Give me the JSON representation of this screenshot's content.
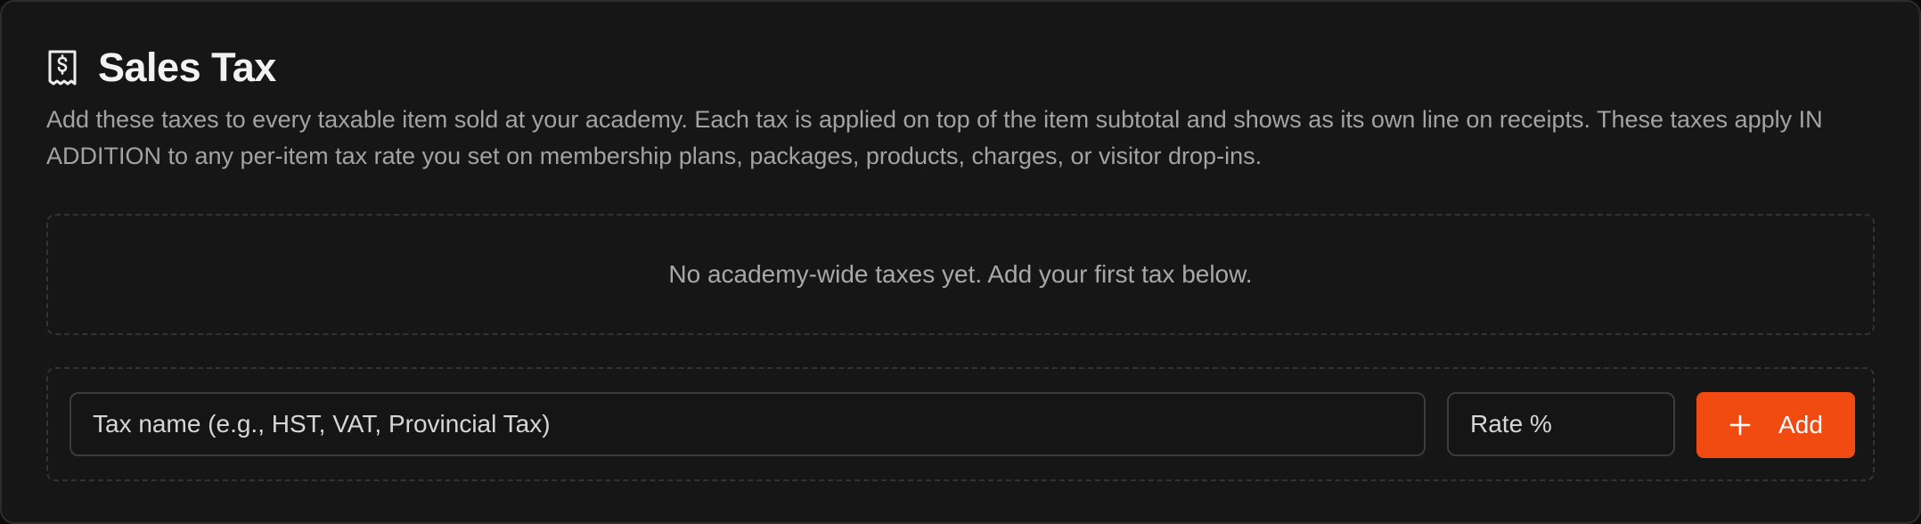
{
  "section": {
    "icon": "receipt-dollar-icon",
    "title": "Sales Tax",
    "description": "Add these taxes to every taxable item sold at your academy. Each tax is applied on top of the item subtotal and shows as its own line on receipts. These taxes apply IN ADDITION to any per-item tax rate you set on membership plans, packages, products, charges, or visitor drop-ins."
  },
  "empty_state": {
    "message": "No academy-wide taxes yet. Add your first tax below."
  },
  "form": {
    "name_placeholder": "Tax name (e.g., HST, VAT, Provincial Tax)",
    "name_value": "",
    "rate_placeholder": "Rate %",
    "rate_value": "",
    "add_label": "Add",
    "add_icon": "plus-icon"
  },
  "colors": {
    "accent": "#f24b12",
    "background": "#161616",
    "text_primary": "#f2f2f2",
    "text_secondary": "#a3a3a3"
  }
}
